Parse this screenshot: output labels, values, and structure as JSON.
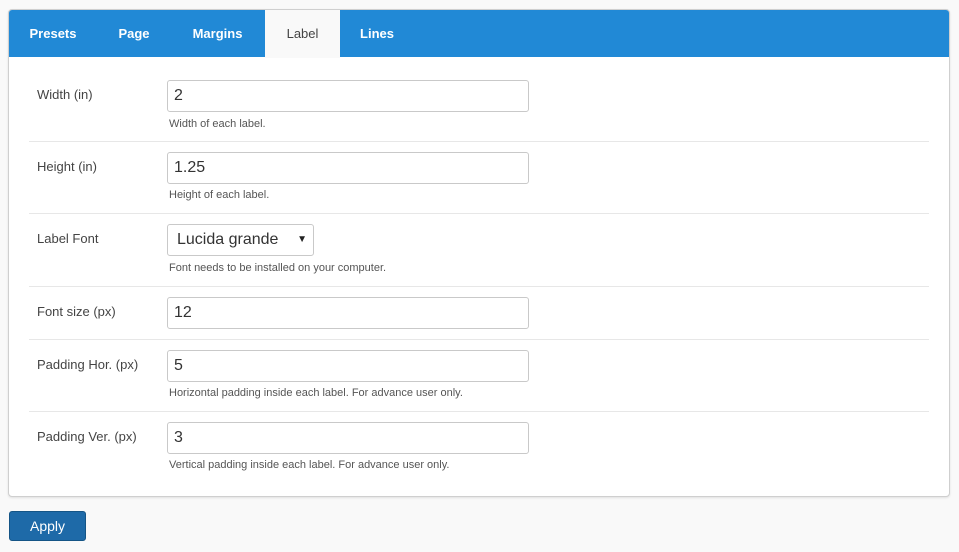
{
  "tabs": [
    {
      "label": "Presets"
    },
    {
      "label": "Page"
    },
    {
      "label": "Margins"
    },
    {
      "label": "Label",
      "active": true
    },
    {
      "label": "Lines"
    }
  ],
  "fields": {
    "width": {
      "label": "Width (in)",
      "value": "2",
      "help": "Width of each label."
    },
    "height": {
      "label": "Height (in)",
      "value": "1.25",
      "help": "Height of each label."
    },
    "font": {
      "label": "Label Font",
      "value": "Lucida grande",
      "help": "Font needs to be installed on your computer."
    },
    "font_size": {
      "label": "Font size (px)",
      "value": "12"
    },
    "padding_hor": {
      "label": "Padding Hor. (px)",
      "value": "5",
      "help": "Horizontal padding inside each label. For advance user only."
    },
    "padding_ver": {
      "label": "Padding Ver. (px)",
      "value": "3",
      "help": "Vertical padding inside each label. For advance user only."
    }
  },
  "apply_label": "Apply",
  "colors": {
    "tabbar": "#2189d6",
    "apply_button": "#1e6aa8"
  }
}
